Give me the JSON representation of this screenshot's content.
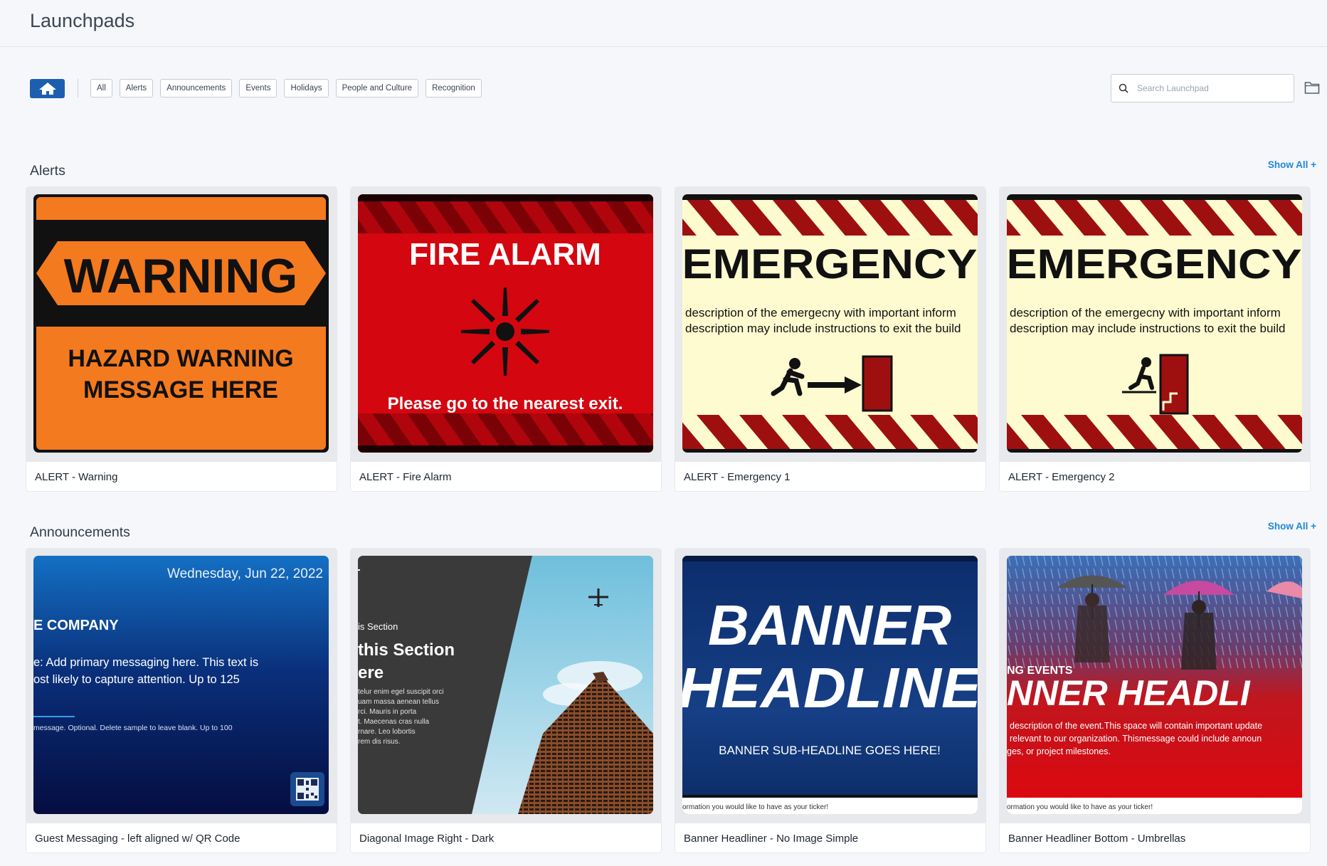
{
  "header": {
    "title": "Launchpads"
  },
  "filters": {
    "chips": [
      "All",
      "Alerts",
      "Announcements",
      "Events",
      "Holidays",
      "People and Culture",
      "Recognition"
    ]
  },
  "search": {
    "placeholder": "Search Launchpad"
  },
  "sections": [
    {
      "title": "Alerts",
      "show_all": "Show All +",
      "cards": [
        {
          "label": "ALERT - Warning",
          "thumb": {
            "heading": "WARNING",
            "line1": "HAZARD WARNING",
            "line2": "MESSAGE HERE"
          }
        },
        {
          "label": "ALERT - Fire Alarm",
          "thumb": {
            "heading": "FIRE ALARM",
            "footer": "Please go to the nearest exit."
          }
        },
        {
          "label": "ALERT - Emergency 1",
          "thumb": {
            "heading": "EMERGENCY",
            "line1": "description of the emergecny with important inform",
            "line2": "description may include instructions to exit the build"
          }
        },
        {
          "label": "ALERT - Emergency 2",
          "thumb": {
            "heading": "EMERGENCY",
            "line1": "description of the emergecny with important inform",
            "line2": "description may include instructions to exit the build"
          }
        }
      ]
    },
    {
      "title": "Announcements",
      "show_all": "Show All +",
      "cards": [
        {
          "label": "Guest Messaging - left aligned w/ QR Code",
          "thumb": {
            "date": "Wednesday, Jun 22, 2022",
            "company": "E COMPANY",
            "line1": "e: Add primary messaging here. This text is",
            "line2": "ost likely to capture attention. Up to 125",
            "line3": "message. Optional. Delete sample to leave blank. Up to 100"
          }
        },
        {
          "label": "Diagonal Image Right - Dark",
          "thumb": {
            "small": "is Section",
            "title1": "this Section",
            "title2": "ere",
            "body1": "telur enim egel suscipit orci",
            "body2": "uam massa aenean tellus",
            "body3": "rci. Mauris in porta",
            "body4": "t. Maecenas cras nulla",
            "body5": "rnare. Leo lobortis",
            "body6": "rem dis risus."
          }
        },
        {
          "label": "Banner Headliner - No Image Simple",
          "thumb": {
            "line1": "BANNER",
            "line2": "HEADLINE",
            "sub": "BANNER SUB-HEADLINE GOES HERE!",
            "ticker": "ormation you would like to have as your ticker!"
          }
        },
        {
          "label": "Banner Headliner Bottom - Umbrellas",
          "thumb": {
            "kicker": "NG EVENTS",
            "headline": "NNER HEADLI",
            "desc1": "description of the event.This space will contain important update",
            "desc2": "relevant to our organization. Thismessage could include announ",
            "desc3": "ges, or project milestones.",
            "ticker": "ormation you would like to have as your ticker!"
          }
        }
      ]
    }
  ],
  "colors": {
    "accent": "#1d5fae",
    "link": "#1e88d8",
    "warning_orange": "#f47a1f",
    "alert_red": "#d4060f"
  }
}
